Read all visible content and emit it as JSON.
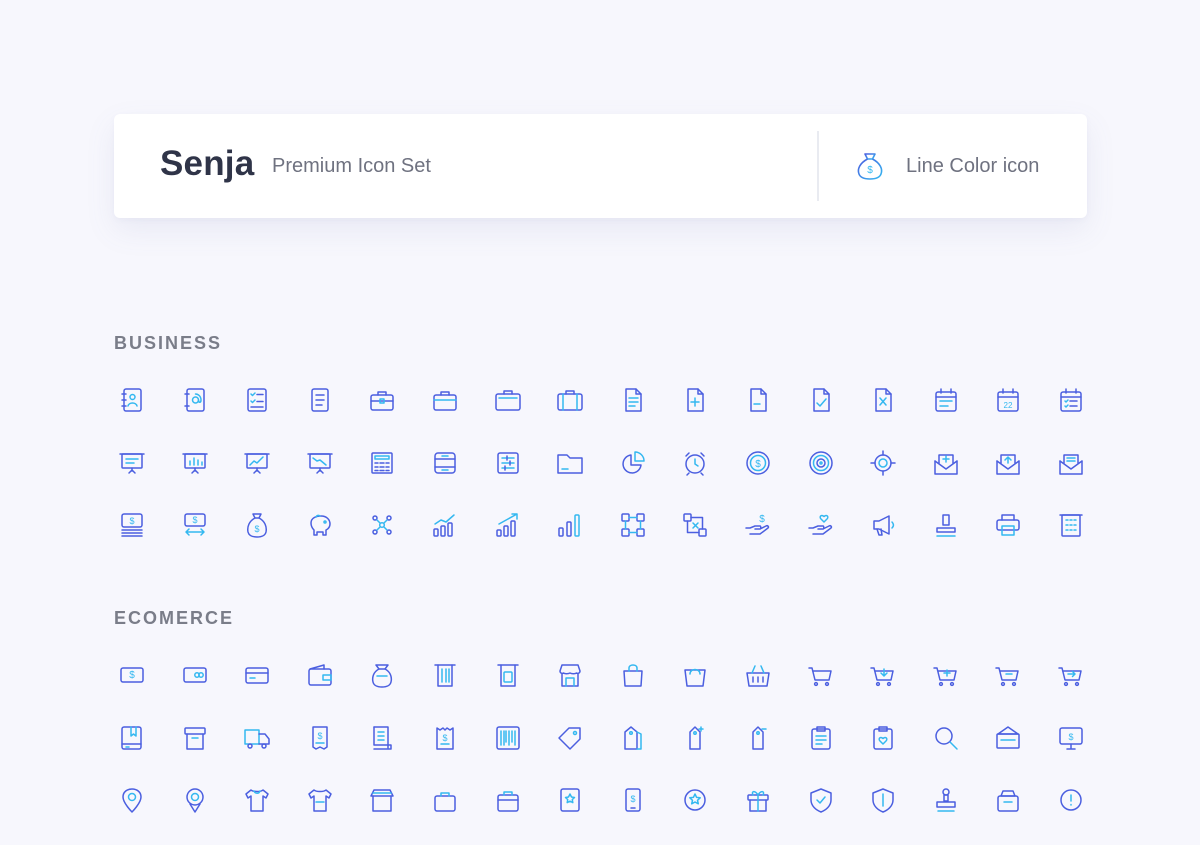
{
  "header": {
    "brand": "Senja",
    "subtitle": "Premium Icon Set",
    "style_icon": "money-bag-icon",
    "style_label": "Line Color icon"
  },
  "colors": {
    "icon_primary": "#4b5fe0",
    "icon_accent": "#34b8f0"
  },
  "sections": [
    {
      "title": "BUSINESS",
      "icons": [
        "contact-book-icon",
        "address-book-at-icon",
        "checklist-icon",
        "document-lines-icon",
        "briefcase-icon",
        "briefcase-bar-icon",
        "briefcase-wide-icon",
        "suitcase-icon",
        "document-text-icon",
        "document-add-icon",
        "document-remove-icon",
        "document-check-icon",
        "document-delete-icon",
        "calendar-icon",
        "calendar-date-icon",
        "calendar-list-icon",
        "presentation-board-icon",
        "presentation-chart-icon",
        "presentation-growth-icon",
        "presentation-decline-icon",
        "calculator-icon",
        "archive-box-icon",
        "list-board-icon",
        "folder-icon",
        "pie-chart-icon",
        "alarm-clock-icon",
        "coin-dollar-icon",
        "target-icon",
        "crosshair-icon",
        "mail-add-icon",
        "mail-upload-icon",
        "mail-open-icon",
        "cash-stack-icon",
        "money-transfer-icon",
        "money-bag-icon",
        "piggy-bank-icon",
        "network-nodes-icon",
        "bar-growth-icon",
        "bar-growth-arrow-icon",
        "bar-chart-icon",
        "workflow-icon",
        "flow-cancel-icon",
        "hand-dollar-icon",
        "hand-heart-icon",
        "megaphone-icon",
        "stamp-icon",
        "printer-icon",
        "building-icon"
      ]
    },
    {
      "title": "ECOMERCE",
      "icons": [
        "banknote-icon",
        "credit-card-coins-icon",
        "credit-card-icon",
        "wallet-icon",
        "coin-pouch-icon",
        "receipt-printer-icon",
        "atm-card-icon",
        "store-icon",
        "shopping-bag-icon",
        "tote-bag-icon",
        "basket-icon",
        "shopping-cart-icon",
        "cart-download-icon",
        "cart-add-icon",
        "cart-remove-icon",
        "cart-forward-icon",
        "catalog-book-icon",
        "package-box-icon",
        "delivery-truck-icon",
        "invoice-dollar-icon",
        "receipt-icon",
        "bill-dollar-icon",
        "barcode-icon",
        "price-tag-icon",
        "double-tag-icon",
        "tag-add-icon",
        "tag-remove-icon",
        "clipboard-list-icon",
        "clipboard-heart-icon",
        "search-icon",
        "shop-sign-icon",
        "monitor-dollar-icon",
        "location-pin-icon",
        "location-pin-alt-icon",
        "t-shirt-icon",
        "t-shirt-alt-icon",
        "storefront-icon",
        "bag-handle-icon",
        "bag-handle-alt-icon",
        "badge-star-icon",
        "phone-dollar-icon",
        "star-badge-icon",
        "gift-box-icon",
        "shield-check-icon",
        "shield-secure-icon",
        "stamp-alt-icon",
        "weight-scale-icon",
        "clock-info-icon"
      ]
    }
  ]
}
